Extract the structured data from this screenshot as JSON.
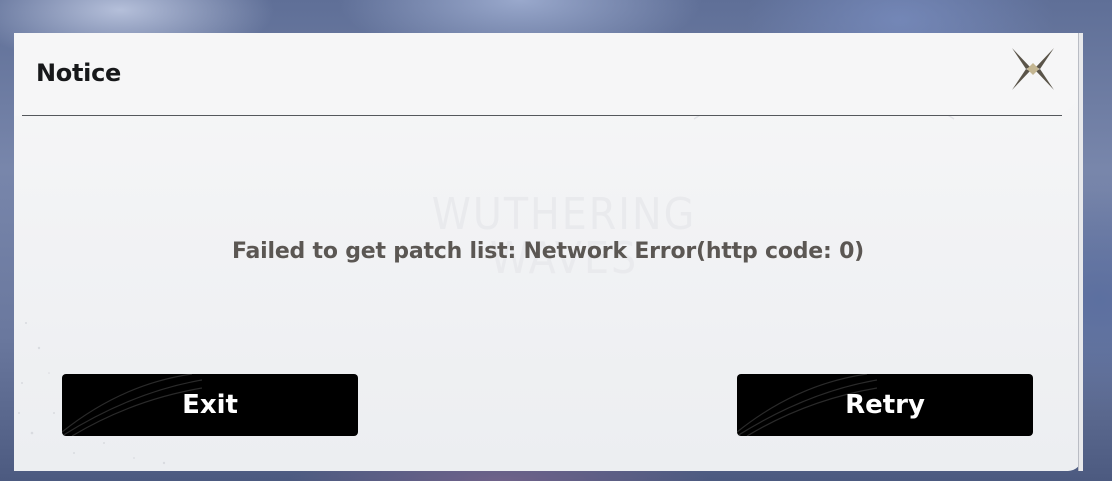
{
  "dialog": {
    "title": "Notice",
    "message": "Failed to get patch list: Network Error(http code: 0)",
    "watermark_line1": "WUTHERING",
    "watermark_line2": "WAVES",
    "close_icon": "close-x-icon",
    "buttons": {
      "exit_label": "Exit",
      "retry_label": "Retry"
    }
  },
  "colors": {
    "title_text": "#17181a",
    "message_text": "#5b5753",
    "button_bg": "#000000",
    "button_text": "#ffffff",
    "close_icon": "#5a5449",
    "dialog_bg": "#f3f4f6"
  }
}
